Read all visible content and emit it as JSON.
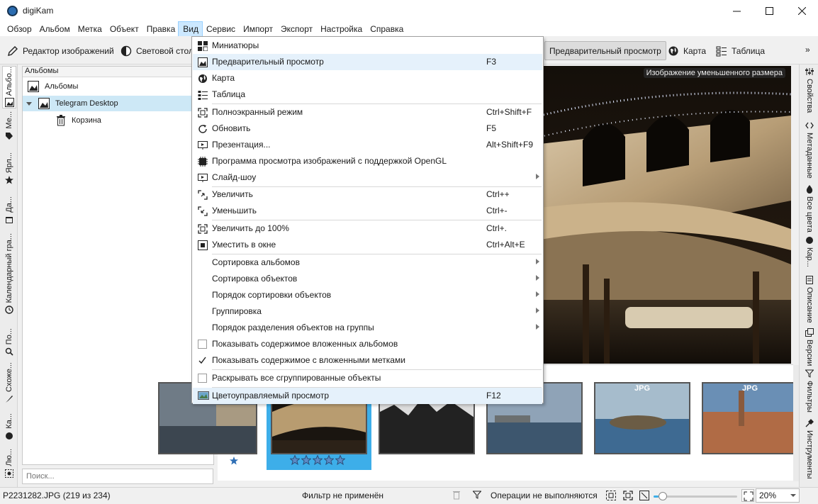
{
  "window": {
    "title": "digiKam",
    "controls": {
      "minimize": "minimize-icon",
      "maximize": "maximize-icon",
      "close": "close-icon"
    }
  },
  "menubar": [
    "Обзор",
    "Альбом",
    "Метка",
    "Объект",
    "Правка",
    "Вид",
    "Сервис",
    "Импорт",
    "Экспорт",
    "Настройка",
    "Справка"
  ],
  "active_menu": "Вид",
  "toolbar": {
    "image_editor": "Редактор изображений",
    "light_table": "Световой стол",
    "preview": "Предварительный просмотр",
    "map": "Карта",
    "table": "Таблица",
    "overflow": "»"
  },
  "left_tabs": [
    "Альбо...",
    "Ме...",
    "Ярл...",
    "Да...",
    "Календарный гра...",
    "По...",
    "Схоже...",
    "Ка...",
    "Лю..."
  ],
  "albums": {
    "header": "Альбомы",
    "root": "Альбомы",
    "items": [
      "Telegram Desktop",
      "Корзина"
    ]
  },
  "search": {
    "placeholder": "Поиск..."
  },
  "view_menu": {
    "items": [
      {
        "label": "Миниатюры",
        "icon": "thumbnails-icon"
      },
      {
        "label": "Предварительный просмотр",
        "icon": "preview-icon",
        "shortcut": "F3"
      },
      {
        "label": "Карта",
        "icon": "globe-icon"
      },
      {
        "label": "Таблица",
        "icon": "table-icon"
      },
      {
        "label": "Полноэкранный режим",
        "icon": "fullscreen-icon",
        "shortcut": "Ctrl+Shift+F"
      },
      {
        "label": "Обновить",
        "icon": "refresh-icon",
        "shortcut": "F5"
      },
      {
        "label": "Презентация...",
        "icon": "presentation-icon",
        "shortcut": "Alt+Shift+F9"
      },
      {
        "label": "Программа просмотра изображений с поддержкой OpenGL",
        "icon": "opengl-icon"
      },
      {
        "label": "Слайд-шоу",
        "icon": "slideshow-icon",
        "submenu": true
      },
      {
        "label": "Увеличить",
        "icon": "zoom-in-icon",
        "shortcut": "Ctrl++"
      },
      {
        "label": "Уменьшить",
        "icon": "zoom-out-icon",
        "shortcut": "Ctrl+-"
      },
      {
        "label": "Увеличить до 100%",
        "icon": "zoom-100-icon",
        "shortcut": "Ctrl+."
      },
      {
        "label": "Уместить в окне",
        "icon": "fit-window-icon",
        "shortcut": "Ctrl+Alt+E"
      },
      {
        "label": "Сортировка альбомов",
        "submenu": true
      },
      {
        "label": "Сортировка объектов",
        "submenu": true
      },
      {
        "label": "Порядок сортировки объектов",
        "submenu": true
      },
      {
        "label": "Группировка",
        "submenu": true
      },
      {
        "label": "Порядок разделения объектов на группы",
        "submenu": true
      },
      {
        "label": "Показывать содержимое вложенных альбомов",
        "checked": false
      },
      {
        "label": "Показывать содержимое с вложенными метками",
        "checked": true
      },
      {
        "label": "Раскрывать все сгруппированные объекты",
        "checked": false
      },
      {
        "label": "Цветоуправляемый просмотр",
        "icon": "color-managed-icon",
        "shortcut": "F12"
      }
    ]
  },
  "preview": {
    "overlay_label": "Изображение уменьшенного размера"
  },
  "thumbnails": {
    "badge": "JPG",
    "selected_rating": 5
  },
  "right_tabs": [
    "Свойства",
    "Метаданные",
    "Все цвета",
    "Кар...",
    "Описание",
    "Версии",
    "Фильтры",
    "Инструменты"
  ],
  "statusbar": {
    "file": "P2231282.JPG (219 из 234)",
    "filter": "Фильтр не применён",
    "operations": "Операции не выполняются",
    "zoom": "20%",
    "zoom_level": 0.06
  }
}
